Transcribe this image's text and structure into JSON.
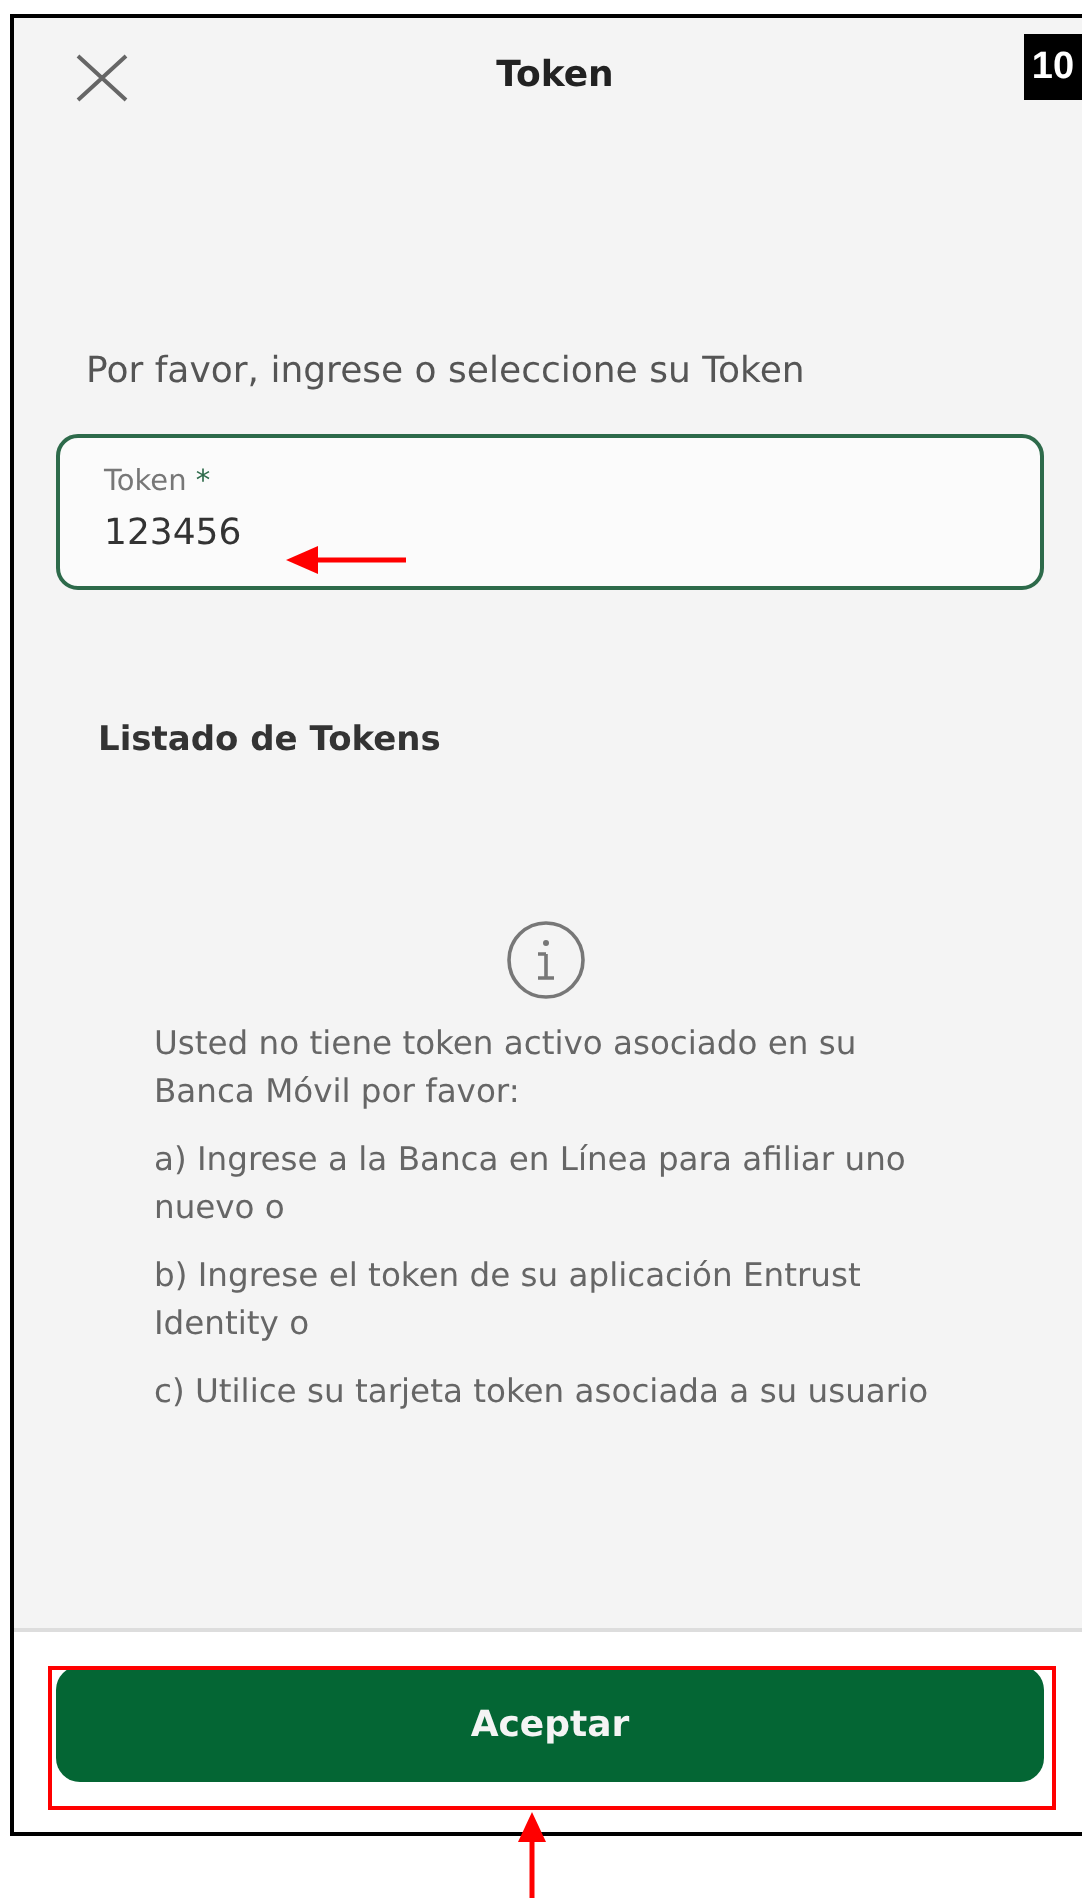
{
  "step_badge": "10",
  "header": {
    "title": "Token"
  },
  "prompt": "Por favor, ingrese o seleccione su Token",
  "token_field": {
    "label": "Token",
    "required_mark": "*",
    "value": "123456"
  },
  "token_list": {
    "title": "Listado de Tokens",
    "message": [
      "Usted no tiene token activo asociado en su Banca Móvil por favor:",
      "a) Ingrese a la Banca en Línea para afiliar uno nuevo o",
      "b) Ingrese el token de su aplicación Entrust Identity o",
      "c) Utilice su tarjeta token asociada a su usuario"
    ]
  },
  "footer": {
    "button": "Aceptar"
  }
}
